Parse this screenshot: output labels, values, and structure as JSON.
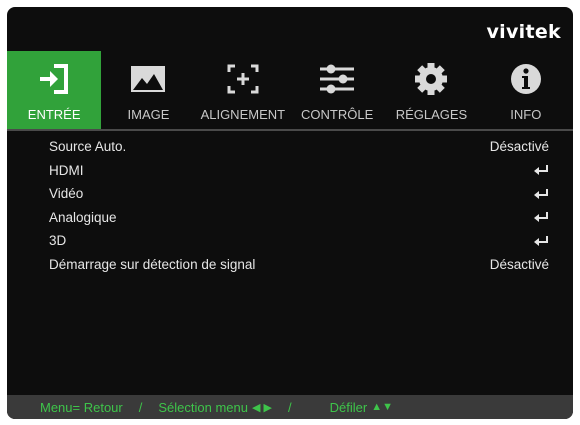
{
  "brand": "vivitek",
  "tabs": [
    {
      "label": "ENTRÉE",
      "icon": "input-icon",
      "active": true
    },
    {
      "label": "IMAGE",
      "icon": "image-icon",
      "active": false
    },
    {
      "label": "ALIGNEMENT",
      "icon": "alignment-icon",
      "active": false
    },
    {
      "label": "CONTRÔLE",
      "icon": "sliders-icon",
      "active": false
    },
    {
      "label": "RÉGLAGES",
      "icon": "gear-icon",
      "active": false
    },
    {
      "label": "INFO",
      "icon": "info-icon",
      "active": false
    }
  ],
  "menu": {
    "items": [
      {
        "label": "Source Auto.",
        "value": "Désactivé"
      },
      {
        "label": "HDMI",
        "value": "",
        "enter": true
      },
      {
        "label": "Vidéo",
        "value": "",
        "enter": true
      },
      {
        "label": "Analogique",
        "value": "",
        "enter": true
      },
      {
        "label": "3D",
        "value": "",
        "enter": true
      },
      {
        "label": "Démarrage sur détection de signal",
        "value": "Désactivé"
      }
    ]
  },
  "footer": {
    "back": "Menu= Retour",
    "separator": "/",
    "select": "Sélection menu",
    "select_arrows": "◀ ▶",
    "scroll": "Défiler",
    "scroll_arrows": "▲▼"
  },
  "colors": {
    "accent": "#31a23a",
    "footer_text": "#3ec44a",
    "background": "#0d0d0d"
  }
}
